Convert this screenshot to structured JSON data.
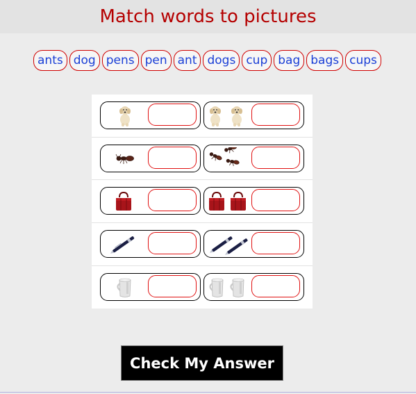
{
  "header": {
    "title": "Match words to pictures"
  },
  "word_bank": [
    "ants",
    "dog",
    "pens",
    "pen",
    "ant",
    "dogs",
    "cup",
    "bag",
    "bags",
    "cups"
  ],
  "rows": [
    {
      "left": {
        "picture": "dog-icon",
        "answer": ""
      },
      "right": {
        "picture": "dogs-icon",
        "answer": ""
      }
    },
    {
      "left": {
        "picture": "ant-icon",
        "answer": ""
      },
      "right": {
        "picture": "ants-icon",
        "answer": ""
      }
    },
    {
      "left": {
        "picture": "bag-icon",
        "answer": ""
      },
      "right": {
        "picture": "bags-icon",
        "answer": ""
      }
    },
    {
      "left": {
        "picture": "pen-icon",
        "answer": ""
      },
      "right": {
        "picture": "pens-icon",
        "answer": ""
      }
    },
    {
      "left": {
        "picture": "cup-icon",
        "answer": ""
      },
      "right": {
        "picture": "cups-icon",
        "answer": ""
      }
    }
  ],
  "check_button": {
    "label": "Check My Answer"
  },
  "colors": {
    "title": "#b50000",
    "chip_text": "#1a3fd6",
    "chip_border": "#d00000",
    "button_bg": "#000000"
  }
}
